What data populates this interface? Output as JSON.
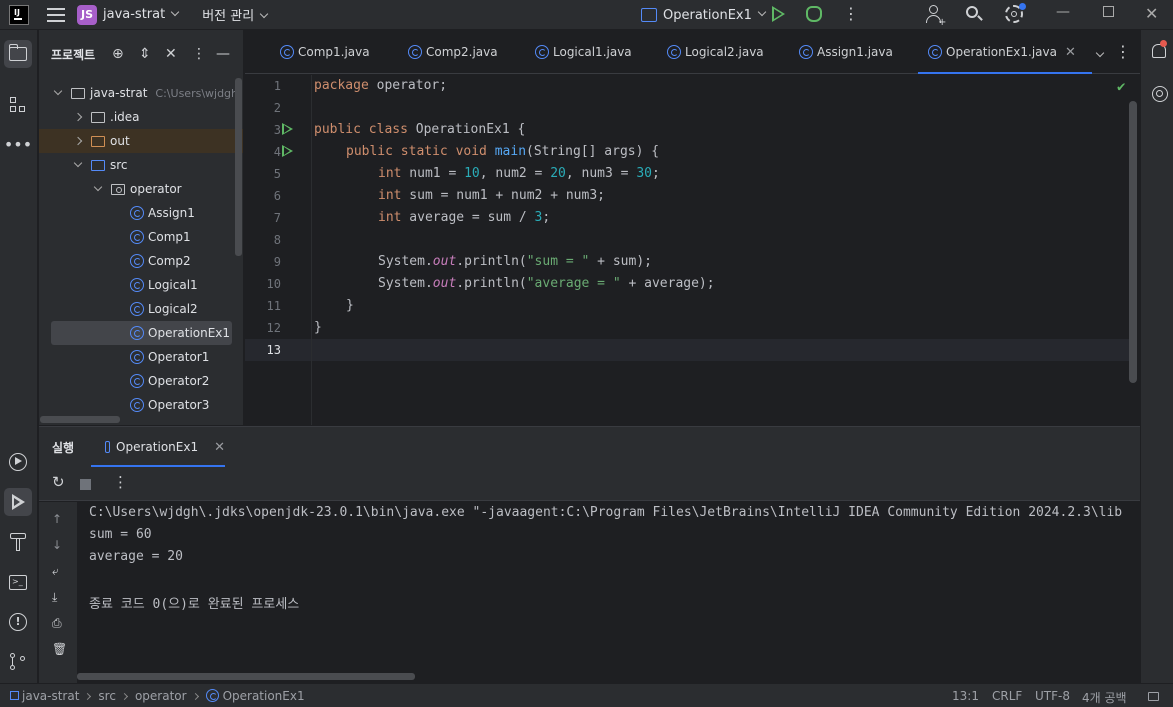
{
  "titlebar": {
    "project_badge": "JS",
    "project_name": "java-strat",
    "vcs_menu": "버전 관리",
    "run_config": "OperationEx1"
  },
  "project_panel": {
    "title": "프로젝트",
    "tree": [
      {
        "label": "java-strat",
        "hint": "C:\\Users\\wjdgh",
        "type": "module",
        "depth": 0
      },
      {
        "label": ".idea",
        "type": "folder",
        "depth": 1
      },
      {
        "label": "out",
        "type": "folder-excluded",
        "depth": 1
      },
      {
        "label": "src",
        "type": "folder-source",
        "depth": 1
      },
      {
        "label": "operator",
        "type": "package",
        "depth": 2
      },
      {
        "label": "Assign1",
        "type": "class",
        "depth": 3
      },
      {
        "label": "Comp1",
        "type": "class",
        "depth": 3
      },
      {
        "label": "Comp2",
        "type": "class",
        "depth": 3
      },
      {
        "label": "Logical1",
        "type": "class",
        "depth": 3
      },
      {
        "label": "Logical2",
        "type": "class",
        "depth": 3
      },
      {
        "label": "OperationEx1",
        "type": "class",
        "depth": 3,
        "selected": true
      },
      {
        "label": "Operator1",
        "type": "class",
        "depth": 3
      },
      {
        "label": "Operator2",
        "type": "class",
        "depth": 3
      },
      {
        "label": "Operator3",
        "type": "class",
        "depth": 3
      }
    ]
  },
  "tabs": [
    {
      "label": "Comp1.java"
    },
    {
      "label": "Comp2.java"
    },
    {
      "label": "Logical1.java"
    },
    {
      "label": "Logical2.java"
    },
    {
      "label": "Assign1.java"
    },
    {
      "label": "OperationEx1.java",
      "active": true
    }
  ],
  "editor": {
    "line_numbers": [
      "1",
      "2",
      "3",
      "4",
      "5",
      "6",
      "7",
      "8",
      "9",
      "10",
      "11",
      "12",
      "13"
    ],
    "code": {
      "l1_kw": "package",
      "l1_rest": " operator;",
      "l3_kw": "public class",
      "l3_rest": " OperationEx1 {",
      "l4_kw": "public static void",
      "l4_fn": "main",
      "l4_rest": "(String[] args) {",
      "l5_kw": "int",
      "l5_a": " num1 = ",
      "l5_n1": "10",
      "l5_b": ", num2 = ",
      "l5_n2": "20",
      "l5_c": ", num3 = ",
      "l5_n3": "30",
      "l5_d": ";",
      "l6_kw": "int",
      "l6_rest": " sum = num1 + num2 + num3;",
      "l7_kw": "int",
      "l7_a": " average = sum / ",
      "l7_n": "3",
      "l7_b": ";",
      "l9_a": "System.",
      "l9_fld": "out",
      "l9_b": ".println(",
      "l9_str": "\"sum = \"",
      "l9_c": " + sum);",
      "l10_a": "System.",
      "l10_fld": "out",
      "l10_b": ".println(",
      "l10_str": "\"average = \"",
      "l10_c": " + average);",
      "l11": "}",
      "l12": "}"
    }
  },
  "run_panel": {
    "title": "실행",
    "tab_label": "OperationEx1",
    "console": [
      "C:\\Users\\wjdgh\\.jdks\\openjdk-23.0.1\\bin\\java.exe \"-javaagent:C:\\Program Files\\JetBrains\\IntelliJ IDEA Community Edition 2024.2.3\\lib",
      "sum = 60",
      "average = 20",
      "",
      "종료 코드 0(으)로 완료된 프로세스"
    ]
  },
  "statusbar": {
    "breadcrumb": [
      "java-strat",
      "src",
      "operator",
      "OperationEx1"
    ],
    "position": "13:1",
    "line_sep": "CRLF",
    "encoding": "UTF-8",
    "indent": "4개 공백"
  },
  "colors": {
    "accent": "#3574f0",
    "run_green": "#5fb865",
    "keyword": "#cf8e6d",
    "number": "#2aacb8",
    "string": "#6aab73",
    "project_badge": "#a75fc9"
  }
}
